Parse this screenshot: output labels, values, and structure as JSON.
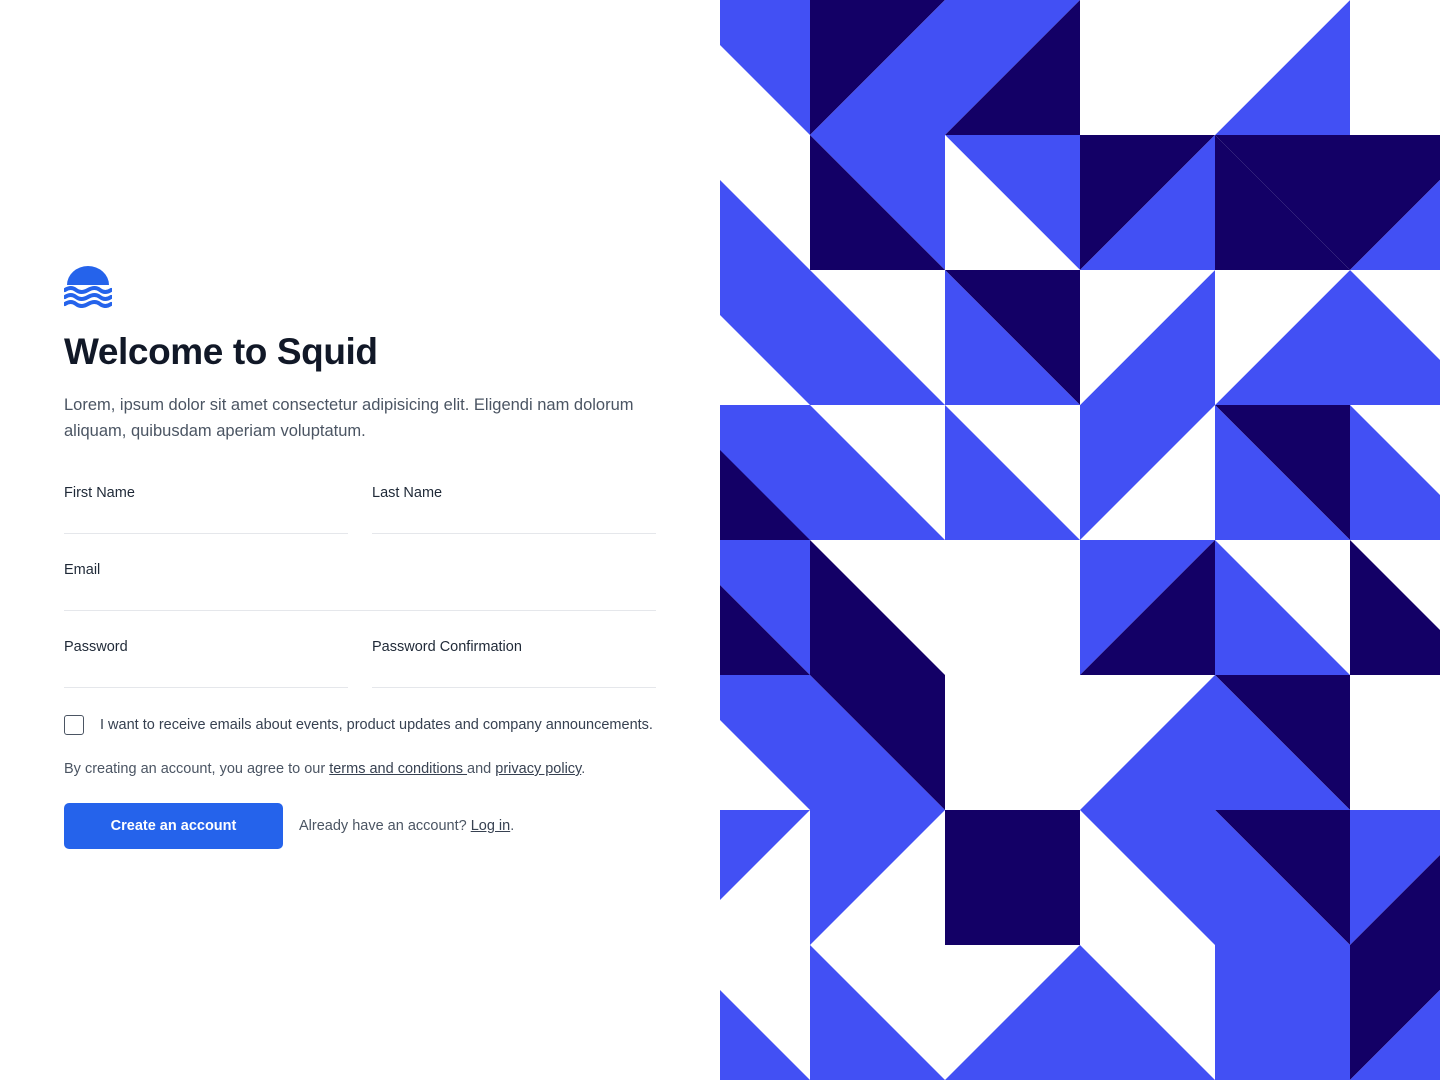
{
  "colors": {
    "brand_blue": "#2563eb",
    "pattern_blue": "#4250f4",
    "pattern_navy": "#130066",
    "text_dark": "#111827",
    "text_muted": "#4b5563"
  },
  "logo": {
    "icon": "waves-logo-icon"
  },
  "heading": {
    "title": "Welcome to Squid",
    "subtitle": "Lorem, ipsum dolor sit amet consectetur adipisicing elit. Eligendi nam dolorum aliquam, quibusdam aperiam voluptatum."
  },
  "form": {
    "first_name": {
      "label": "First Name",
      "value": ""
    },
    "last_name": {
      "label": "Last Name",
      "value": ""
    },
    "email": {
      "label": "Email",
      "value": ""
    },
    "password": {
      "label": "Password",
      "value": ""
    },
    "password_confirmation": {
      "label": "Password Confirmation",
      "value": ""
    },
    "marketing_opt_in": {
      "label": "I want to receive emails about events, product updates and company announcements.",
      "checked": false
    },
    "terms": {
      "prefix": "By creating an account, you agree to our ",
      "terms_link": "terms and conditions ",
      "middle": "and ",
      "privacy_link": "privacy policy",
      "suffix": "."
    },
    "submit_label": "Create an account",
    "login": {
      "prefix": "Already have an account? ",
      "link": "Log in",
      "suffix": "."
    }
  }
}
